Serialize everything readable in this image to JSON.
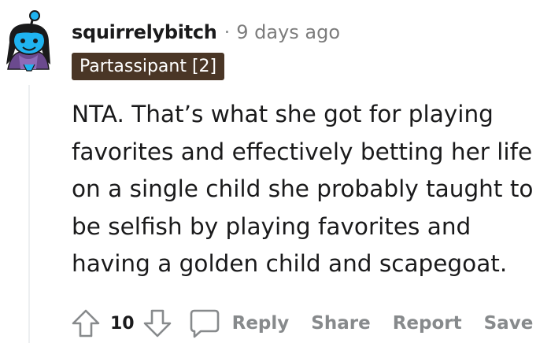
{
  "comment": {
    "username": "squirrelybitch",
    "separator": "·",
    "timestamp": "9 days ago",
    "flair": "Partassipant [2]",
    "body": "NTA. That’s what she got for playing favorites and effectively betting her life on a single child she probably taught to be selfish by playing favorites and having a golden child and scapegoat.",
    "avatar_icon": "snoo-avatar-icon"
  },
  "actions": {
    "upvote_icon": "upvote-arrow-icon",
    "vote_count": "10",
    "downvote_icon": "downvote-arrow-icon",
    "reply_icon": "speech-bubble-icon",
    "reply_label": "Reply",
    "share_label": "Share",
    "report_label": "Report",
    "save_label": "Save"
  },
  "colors": {
    "flair_background": "#4a3626",
    "flair_text": "#ffffff",
    "muted_text": "#878a8c",
    "avatar_primary": "#1fb3f0"
  }
}
